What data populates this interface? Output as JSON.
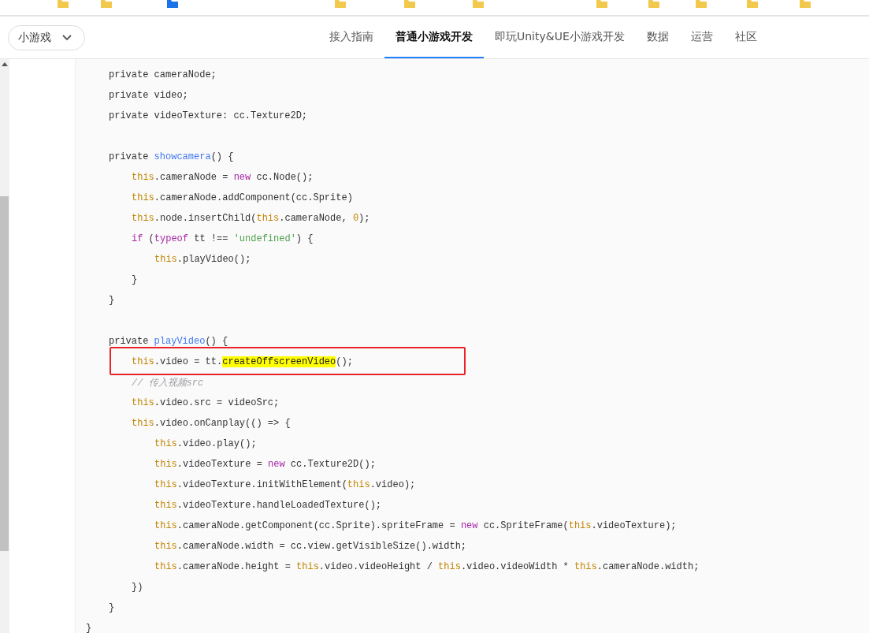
{
  "product_dropdown": {
    "label": "小游戏"
  },
  "nav_tabs": [
    {
      "label": "接入指南",
      "selected": false
    },
    {
      "label": "普通小游戏开发",
      "selected": true
    },
    {
      "label": "即玩Unity&UE小游戏开发",
      "selected": false
    },
    {
      "label": "数据",
      "selected": false
    },
    {
      "label": "运营",
      "selected": false
    },
    {
      "label": "社区",
      "selected": false
    }
  ],
  "code": {
    "lines": [
      {
        "tokens": [
          {
            "kind": "plain",
            "text": "private cameraNode;"
          }
        ]
      },
      {
        "tokens": [
          {
            "kind": "plain",
            "text": "private video;"
          }
        ]
      },
      {
        "tokens": [
          {
            "kind": "plain",
            "text": "private videoTexture: cc.Texture2D;"
          }
        ]
      },
      {
        "blank": true
      },
      {
        "tokens": [
          {
            "kind": "plain",
            "text": "private "
          },
          {
            "kind": "function",
            "text": "showcamera"
          },
          {
            "kind": "plain",
            "text": "() {"
          }
        ],
        "children": [
          {
            "tokens": [
              {
                "kind": "this",
                "text": "this"
              },
              {
                "kind": "plain",
                "text": ".cameraNode = "
              },
              {
                "kind": "keyword",
                "text": "new"
              },
              {
                "kind": "plain",
                "text": " cc.Node();"
              }
            ]
          },
          {
            "tokens": [
              {
                "kind": "this",
                "text": "this"
              },
              {
                "kind": "plain",
                "text": ".cameraNode.addComponent(cc.Sprite)"
              }
            ]
          },
          {
            "tokens": [
              {
                "kind": "this",
                "text": "this"
              },
              {
                "kind": "plain",
                "text": ".node.insertChild("
              },
              {
                "kind": "this",
                "text": "this"
              },
              {
                "kind": "plain",
                "text": ".cameraNode, "
              },
              {
                "kind": "number",
                "text": "0"
              },
              {
                "kind": "plain",
                "text": ");"
              }
            ]
          },
          {
            "tokens": [
              {
                "kind": "keyword",
                "text": "if"
              },
              {
                "kind": "plain",
                "text": " ("
              },
              {
                "kind": "keyword",
                "text": "typeof"
              },
              {
                "kind": "plain",
                "text": " tt !== "
              },
              {
                "kind": "string",
                "text": "'undefined'"
              },
              {
                "kind": "plain",
                "text": ") {"
              }
            ],
            "children": [
              {
                "tokens": [
                  {
                    "kind": "this",
                    "text": "this"
                  },
                  {
                    "kind": "plain",
                    "text": ".playVideo();"
                  }
                ]
              }
            ]
          },
          {
            "tokens": [
              {
                "kind": "plain",
                "text": "}"
              }
            ]
          }
        ]
      },
      {
        "tokens": [
          {
            "kind": "plain",
            "text": "}"
          }
        ]
      },
      {
        "blank": true
      },
      {
        "tokens": [
          {
            "kind": "plain",
            "text": "private "
          },
          {
            "kind": "function",
            "text": "playVideo"
          },
          {
            "kind": "plain",
            "text": "() {"
          }
        ],
        "children": [
          {
            "boxed": true,
            "tokens": [
              {
                "kind": "this",
                "text": "this"
              },
              {
                "kind": "plain",
                "text": ".video = tt."
              },
              {
                "kind": "highlight",
                "text": "createOffscreenVideo"
              },
              {
                "kind": "plain",
                "text": "();"
              }
            ]
          },
          {
            "tokens": [
              {
                "kind": "comment",
                "text": "// 传入视频src"
              }
            ]
          },
          {
            "tokens": [
              {
                "kind": "this",
                "text": "this"
              },
              {
                "kind": "plain",
                "text": ".video.src = videoSrc;"
              }
            ]
          },
          {
            "tokens": [
              {
                "kind": "this",
                "text": "this"
              },
              {
                "kind": "plain",
                "text": ".video.onCanplay(() => {"
              }
            ],
            "children": [
              {
                "tokens": [
                  {
                    "kind": "this",
                    "text": "this"
                  },
                  {
                    "kind": "plain",
                    "text": ".video.play();"
                  }
                ]
              },
              {
                "tokens": [
                  {
                    "kind": "this",
                    "text": "this"
                  },
                  {
                    "kind": "plain",
                    "text": ".videoTexture = "
                  },
                  {
                    "kind": "keyword",
                    "text": "new"
                  },
                  {
                    "kind": "plain",
                    "text": " cc.Texture2D();"
                  }
                ]
              },
              {
                "tokens": [
                  {
                    "kind": "this",
                    "text": "this"
                  },
                  {
                    "kind": "plain",
                    "text": ".videoTexture.initWithElement("
                  },
                  {
                    "kind": "this",
                    "text": "this"
                  },
                  {
                    "kind": "plain",
                    "text": ".video);"
                  }
                ]
              },
              {
                "tokens": [
                  {
                    "kind": "this",
                    "text": "this"
                  },
                  {
                    "kind": "plain",
                    "text": ".videoTexture.handleLoadedTexture();"
                  }
                ]
              },
              {
                "tokens": [
                  {
                    "kind": "this",
                    "text": "this"
                  },
                  {
                    "kind": "plain",
                    "text": ".cameraNode.getComponent(cc.Sprite).spriteFrame = "
                  },
                  {
                    "kind": "keyword",
                    "text": "new"
                  },
                  {
                    "kind": "plain",
                    "text": " cc.SpriteFrame("
                  },
                  {
                    "kind": "this",
                    "text": "this"
                  },
                  {
                    "kind": "plain",
                    "text": ".videoTexture);"
                  }
                ]
              },
              {
                "tokens": [
                  {
                    "kind": "this",
                    "text": "this"
                  },
                  {
                    "kind": "plain",
                    "text": ".cameraNode.width = cc.view.getVisibleSize().width;"
                  }
                ]
              },
              {
                "tokens": [
                  {
                    "kind": "this",
                    "text": "this"
                  },
                  {
                    "kind": "plain",
                    "text": ".cameraNode.height = "
                  },
                  {
                    "kind": "this",
                    "text": "this"
                  },
                  {
                    "kind": "plain",
                    "text": ".video.videoHeight / "
                  },
                  {
                    "kind": "this",
                    "text": "this"
                  },
                  {
                    "kind": "plain",
                    "text": ".video.videoWidth * "
                  },
                  {
                    "kind": "this",
                    "text": "this"
                  },
                  {
                    "kind": "plain",
                    "text": ".cameraNode.width;"
                  }
                ]
              }
            ]
          },
          {
            "tokens": [
              {
                "kind": "plain",
                "text": "})"
              }
            ]
          }
        ]
      },
      {
        "tokens": [
          {
            "kind": "plain",
            "text": "}"
          }
        ]
      }
    ],
    "end_line": [
      {
        "kind": "plain",
        "text": "}"
      }
    ]
  }
}
